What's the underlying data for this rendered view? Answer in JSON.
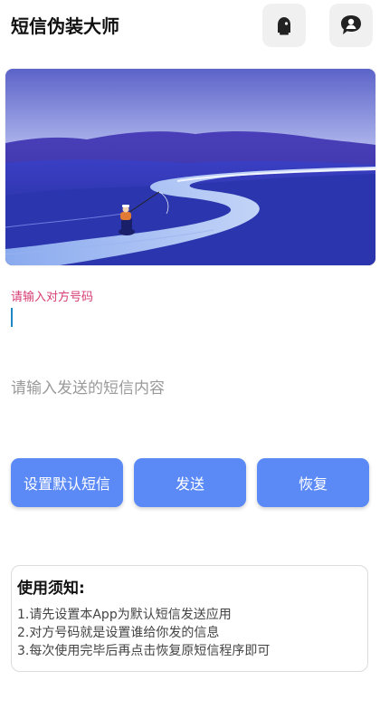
{
  "header": {
    "title": "短信伪装大师",
    "icons": [
      "ghost-icon",
      "chat-bubble-icon"
    ]
  },
  "banner": {
    "image": "landscape-fishing-illustration"
  },
  "form": {
    "phone_label": "请输入对方号码",
    "phone_value": "",
    "content_placeholder": "请输入发送的短信内容",
    "content_value": ""
  },
  "actions": {
    "set_default_label": "设置默认短信",
    "send_label": "发送",
    "restore_label": "恢复"
  },
  "notice": {
    "title": "使用须知:",
    "lines": [
      "1.请先设置本App为默认短信发送应用",
      "2.对方号码就是设置谁给你发的信息",
      "3.每次使用完毕后再点击恢复原短信程序即可"
    ]
  },
  "colors": {
    "accent": "#5b8af7",
    "label": "#d63b72",
    "caret": "#1e88c7"
  }
}
